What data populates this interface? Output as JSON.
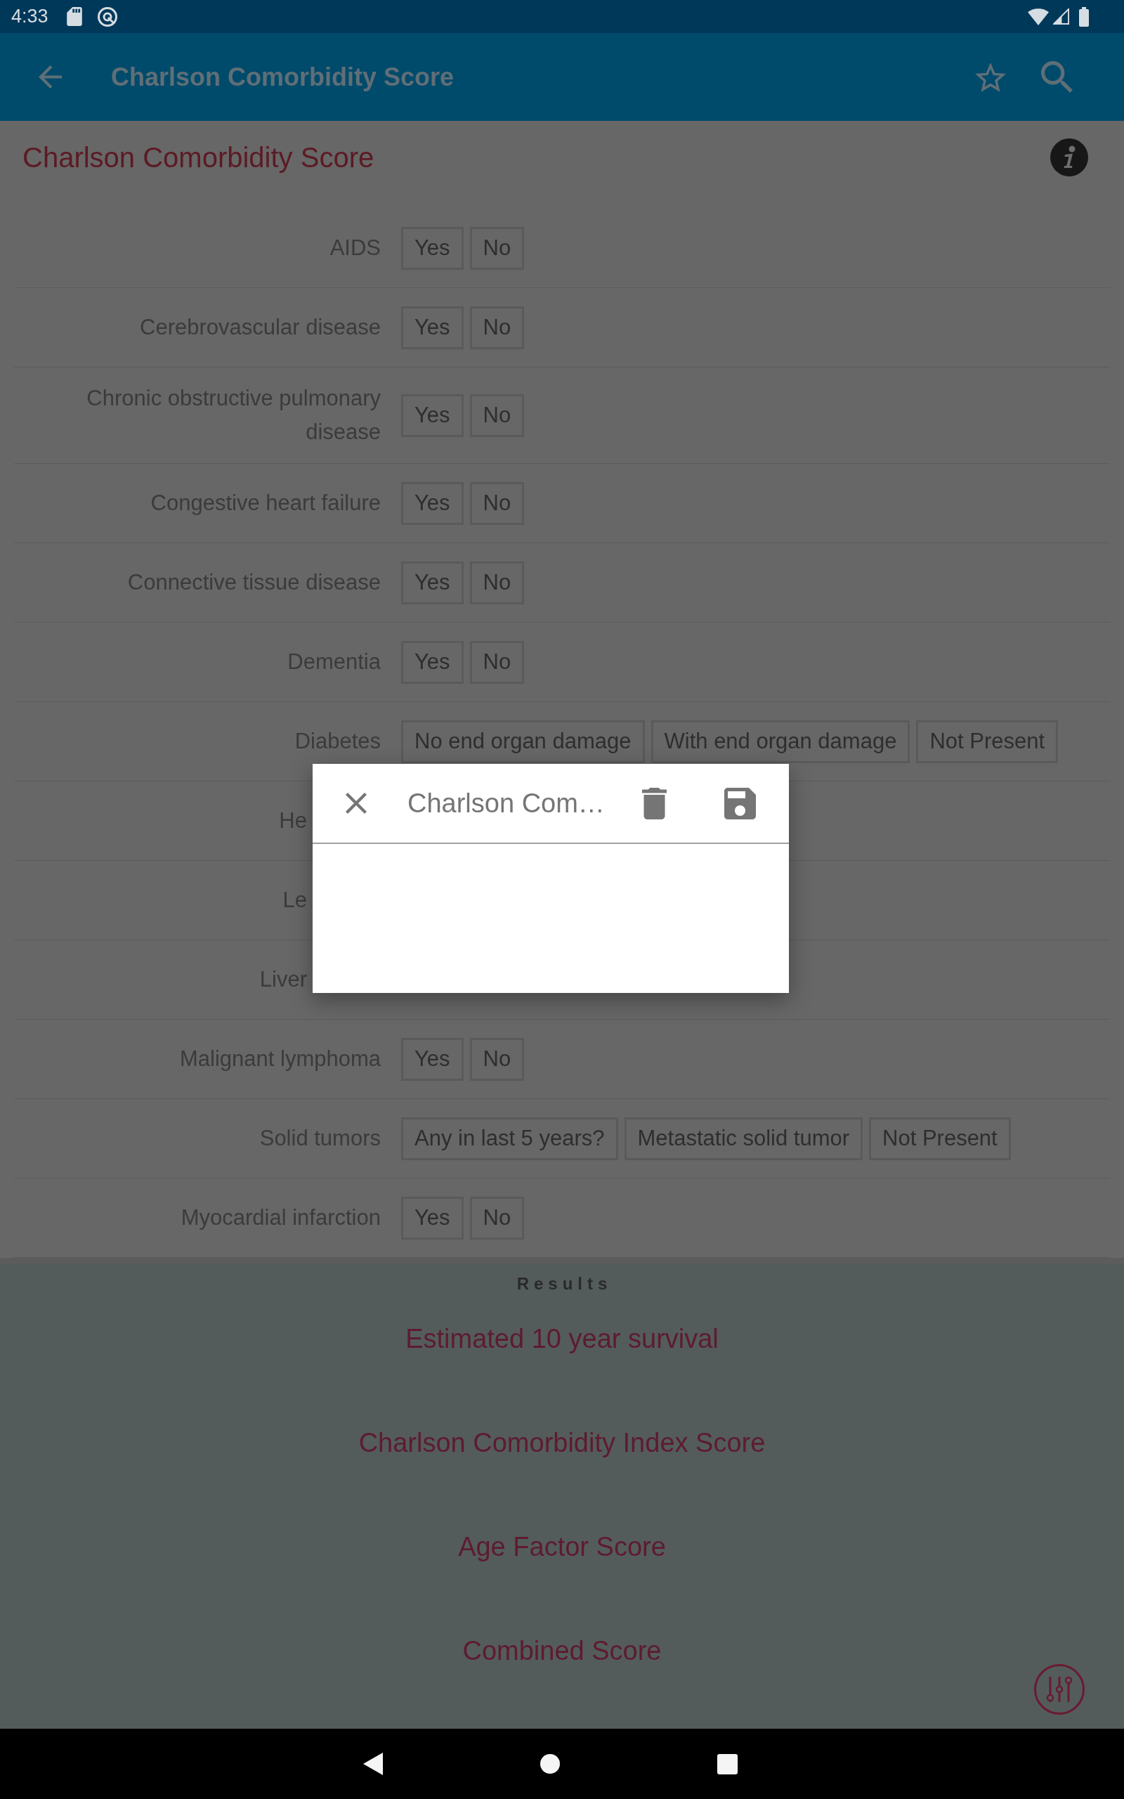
{
  "status_bar": {
    "time": "4:33"
  },
  "app_bar": {
    "title": "Charlson Comorbidity Score"
  },
  "calculator": {
    "title": "Charlson Comorbidity Score",
    "rows": [
      {
        "label": "AIDS",
        "options": [
          {
            "label": "Yes",
            "selected": false
          },
          {
            "label": "No",
            "selected": false
          }
        ]
      },
      {
        "label": "Cerebrovascular disease",
        "options": [
          {
            "label": "Yes",
            "selected": false
          },
          {
            "label": "No",
            "selected": false
          }
        ]
      },
      {
        "label": "Chronic obstructive pulmonary disease",
        "options": [
          {
            "label": "Yes",
            "selected": false
          },
          {
            "label": "No",
            "selected": false
          }
        ]
      },
      {
        "label": "Congestive heart failure",
        "options": [
          {
            "label": "Yes",
            "selected": false
          },
          {
            "label": "No",
            "selected": false
          }
        ]
      },
      {
        "label": "Connective tissue disease",
        "options": [
          {
            "label": "Yes",
            "selected": false
          },
          {
            "label": "No",
            "selected": false
          }
        ]
      },
      {
        "label": "Dementia",
        "options": [
          {
            "label": "Yes",
            "selected": false
          },
          {
            "label": "No",
            "selected": false
          }
        ]
      },
      {
        "label": "Diabetes",
        "options": [
          {
            "label": "No end organ damage",
            "selected": false
          },
          {
            "label": "With end organ damage",
            "selected": false
          },
          {
            "label": "Not Present",
            "selected": false
          }
        ]
      },
      {
        "label": "He"
      },
      {
        "label": "Le"
      },
      {
        "label": "Liver"
      },
      {
        "label": "Malignant lymphoma",
        "options": [
          {
            "label": "Yes",
            "selected": false
          },
          {
            "label": "No",
            "selected": false
          }
        ]
      },
      {
        "label": "Solid tumors",
        "options": [
          {
            "label": "Any in last 5 years?",
            "selected": false
          },
          {
            "label": "Metastatic solid tumor",
            "selected": false
          },
          {
            "label": "Not Present",
            "selected": false
          }
        ]
      },
      {
        "label": "Myocardial infarction",
        "options": [
          {
            "label": "Yes",
            "selected": false
          },
          {
            "label": "No",
            "selected": false
          }
        ]
      }
    ]
  },
  "results": {
    "heading": "Results",
    "items": [
      "Estimated 10 year survival",
      "Charlson Comorbidity Index Score",
      "Age Factor Score",
      "Combined Score"
    ]
  },
  "dialog": {
    "title": "Charlson Com…"
  }
}
